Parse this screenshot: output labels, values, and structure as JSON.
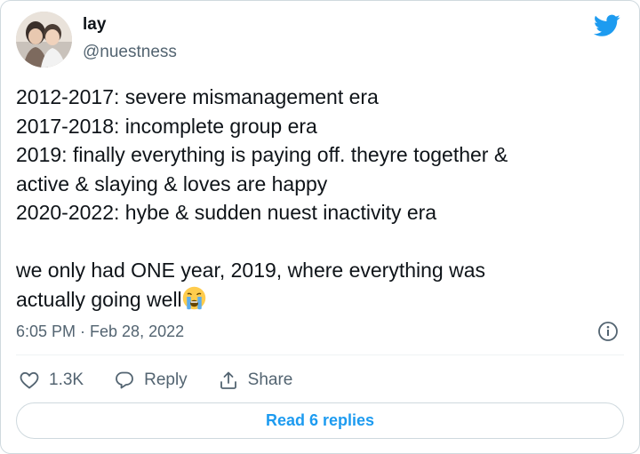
{
  "author": {
    "display_name": "lay",
    "handle": "@nuestness",
    "avatar_icon": "profile-photo"
  },
  "brand": {
    "icon": "twitter-bird-icon",
    "color": "#1d9bf0"
  },
  "tweet": {
    "lines": [
      "2012-2017: severe mismanagement era",
      "2017-2018: incomplete group era",
      "2019: finally everything is paying off. theyre together &",
      "active & slaying & loves are happy",
      "2020-2022: hybe & sudden nuest inactivity era",
      "",
      "we only had ONE year, 2019, where everything was",
      "actually going well"
    ],
    "emoji": "loudly-crying-face",
    "timestamp": "6:05 PM · Feb 28, 2022"
  },
  "actions": {
    "like_count": "1.3K",
    "reply_label": "Reply",
    "share_label": "Share"
  },
  "replies_button": {
    "label": "Read 6 replies"
  },
  "colors": {
    "text": "#0f1419",
    "secondary": "#536471",
    "border": "#cfd9de",
    "accent": "#1d9bf0"
  }
}
